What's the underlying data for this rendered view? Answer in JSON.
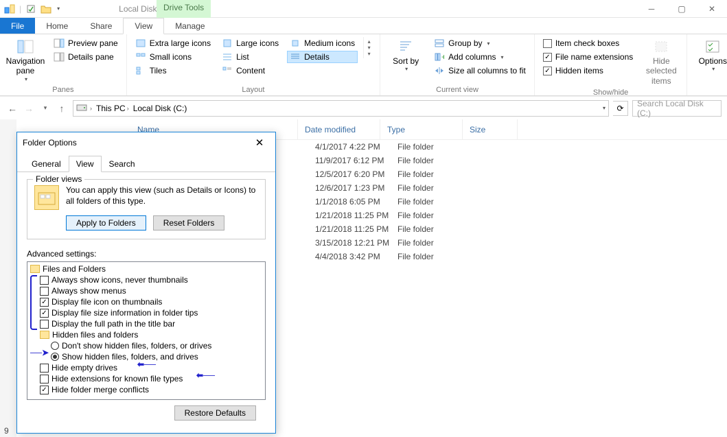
{
  "titlebar": {
    "title": "Local Disk (C:)",
    "contextual": "Drive Tools"
  },
  "tabs": {
    "file": "File",
    "home": "Home",
    "share": "Share",
    "view": "View",
    "manage": "Manage"
  },
  "ribbon": {
    "panes": {
      "title": "Panes",
      "navigation": "Navigation pane",
      "preview": "Preview pane",
      "details": "Details pane"
    },
    "layout": {
      "title": "Layout",
      "xlicons": "Extra large icons",
      "licons": "Large icons",
      "micons": "Medium icons",
      "sicons": "Small icons",
      "list": "List",
      "details": "Details",
      "tiles": "Tiles",
      "content": "Content"
    },
    "currentview": {
      "title": "Current view",
      "sortby": "Sort by",
      "groupby": "Group by",
      "addcols": "Add columns",
      "sizeall": "Size all columns to fit"
    },
    "showhide": {
      "title": "Show/hide",
      "itemcheck": "Item check boxes",
      "filext": "File name extensions",
      "hidden": "Hidden items",
      "hidesel": "Hide selected items"
    },
    "options": "Options"
  },
  "addr": {
    "thispc": "This PC",
    "localdisk": "Local Disk (C:)"
  },
  "search": {
    "placeholder": "Search Local Disk (C:)"
  },
  "columns": {
    "name": "Name",
    "date": "Date modified",
    "type": "Type",
    "size": "Size"
  },
  "rows": [
    {
      "date": "4/1/2017 4:22 PM",
      "type": "File folder"
    },
    {
      "date": "11/9/2017 6:12 PM",
      "type": "File folder"
    },
    {
      "date": "12/5/2017 6:20 PM",
      "type": "File folder"
    },
    {
      "date": "12/6/2017 1:23 PM",
      "type": "File folder"
    },
    {
      "date": "1/1/2018 6:05 PM",
      "type": "File folder"
    },
    {
      "date": "1/21/2018 11:25 PM",
      "type": "File folder"
    },
    {
      "date": "1/21/2018 11:25 PM",
      "type": "File folder"
    },
    {
      "date": "3/15/2018 12:21 PM",
      "type": "File folder"
    },
    {
      "date": "4/4/2018 3:42 PM",
      "type": "File folder"
    }
  ],
  "dialog": {
    "title": "Folder Options",
    "tabs": {
      "general": "General",
      "view": "View",
      "search": "Search"
    },
    "fv": {
      "legend": "Folder views",
      "text1": "You can apply this view (such as Details or Icons) to",
      "text2": "all folders of this type.",
      "apply": "Apply to Folders",
      "reset": "Reset Folders"
    },
    "adv": {
      "label": "Advanced settings:",
      "root": "Files and Folders",
      "items": [
        {
          "kind": "cb",
          "checked": false,
          "label": "Always show icons, never thumbnails"
        },
        {
          "kind": "cb",
          "checked": false,
          "label": "Always show menus"
        },
        {
          "kind": "cb",
          "checked": true,
          "label": "Display file icon on thumbnails"
        },
        {
          "kind": "cb",
          "checked": true,
          "label": "Display file size information in folder tips"
        },
        {
          "kind": "cb",
          "checked": false,
          "label": "Display the full path in the title bar"
        },
        {
          "kind": "folder",
          "label": "Hidden files and folders"
        },
        {
          "kind": "rb",
          "checked": false,
          "label": "Don't show hidden files, folders, or drives"
        },
        {
          "kind": "rb",
          "checked": true,
          "label": "Show hidden files, folders, and drives"
        },
        {
          "kind": "cb",
          "checked": false,
          "label": "Hide empty drives"
        },
        {
          "kind": "cb",
          "checked": false,
          "label": "Hide extensions for known file types"
        },
        {
          "kind": "cb",
          "checked": true,
          "label": "Hide folder merge conflicts"
        }
      ],
      "restore": "Restore Defaults"
    }
  },
  "footer": {
    "count": "9"
  }
}
